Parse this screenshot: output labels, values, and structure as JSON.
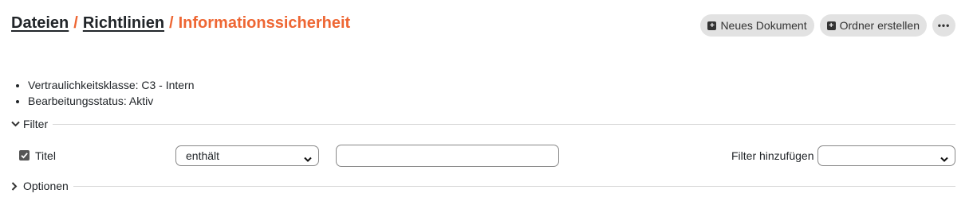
{
  "breadcrumb": {
    "items": [
      "Dateien",
      "Richtlinien"
    ],
    "separator": "/",
    "current": "Informationssicherheit"
  },
  "toolbar": {
    "new_document_label": "Neues Dokument",
    "create_folder_label": "Ordner erstellen",
    "more_label": "•••"
  },
  "meta": [
    "Vertraulichkeitsklasse: C3 - Intern",
    "Bearbeitungsstatus: Aktiv"
  ],
  "filter": {
    "section_label": "Filter",
    "expanded": true,
    "field_label": "Titel",
    "field_checked": true,
    "operator_value": "enthält",
    "text_value": "",
    "add_filter_label": "Filter hinzufügen",
    "add_filter_value": ""
  },
  "options": {
    "section_label": "Optionen",
    "expanded": false
  },
  "colors": {
    "accent": "#ee6633",
    "button_bg": "#e2e2e2",
    "text": "#212529"
  }
}
